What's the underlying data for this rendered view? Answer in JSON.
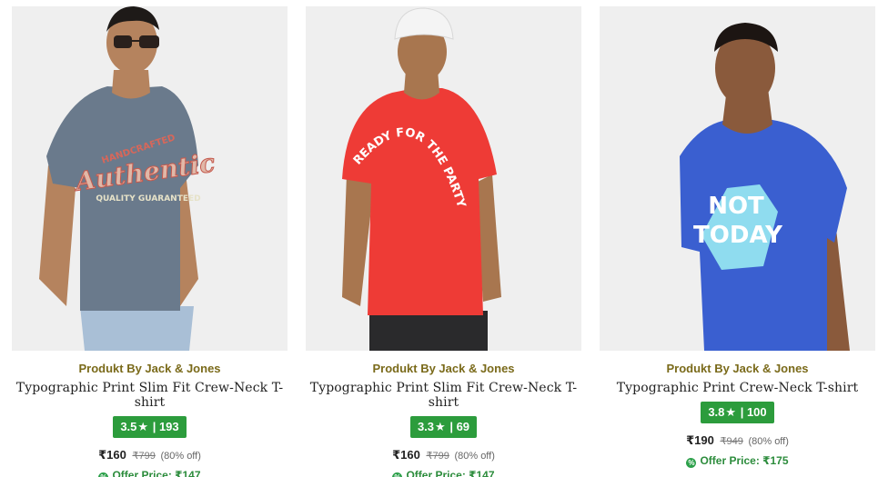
{
  "products": [
    {
      "brand": "Produkt By Jack & Jones",
      "title": "Typographic Print Slim Fit Crew-Neck T-shirt",
      "rating": "3.5",
      "reviews": "193",
      "price": "₹160",
      "mrp": "₹799",
      "discount": "(80% off)",
      "offer_label": "Offer Price: ₹147",
      "shirt_color": "#6a7a8c",
      "print_text_a": "Authentic",
      "print_text_b": "HANDCRAFTED",
      "print_text_c": "QUALITY GUARANTEED"
    },
    {
      "brand": "Produkt By Jack & Jones",
      "title": "Typographic Print Slim Fit Crew-Neck T-shirt",
      "rating": "3.3",
      "reviews": "69",
      "price": "₹160",
      "mrp": "₹799",
      "discount": "(80% off)",
      "offer_label": "Offer Price: ₹147",
      "shirt_color": "#ee3b36",
      "print_text_a": "READY FOR THE PARTY"
    },
    {
      "brand": "Produkt By Jack & Jones",
      "title": "Typographic Print Crew-Neck T-shirt",
      "rating": "3.8",
      "reviews": "100",
      "price": "₹190",
      "mrp": "₹949",
      "discount": "(80% off)",
      "offer_label": "Offer Price: ₹175",
      "shirt_color": "#3a5fd0",
      "print_text_a": "NOT",
      "print_text_b": "TODAY"
    }
  ],
  "rating_star": "★",
  "rating_sep": "|",
  "offer_icon_glyph": "%"
}
